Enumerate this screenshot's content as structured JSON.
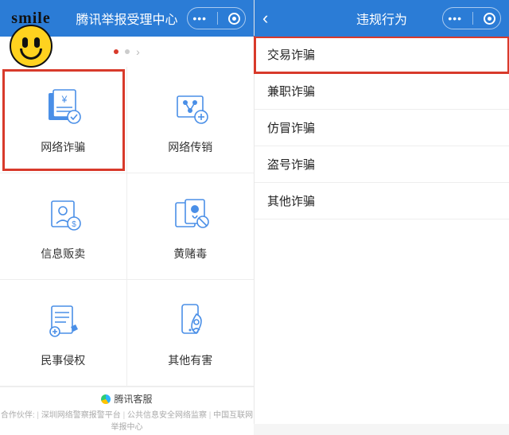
{
  "left": {
    "title": "腾讯举报受理中心",
    "smile_text": "smile",
    "grid": [
      {
        "label": "网络诈骗",
        "icon": "fraud",
        "highlight": true
      },
      {
        "label": "网络传销",
        "icon": "pyramid",
        "highlight": false
      },
      {
        "label": "信息贩卖",
        "icon": "info-sell",
        "highlight": false
      },
      {
        "label": "黄赌毒",
        "icon": "illegal",
        "highlight": false
      },
      {
        "label": "民事侵权",
        "icon": "civil",
        "highlight": false
      },
      {
        "label": "其他有害",
        "icon": "other",
        "highlight": false
      }
    ],
    "footer_brand": "腾讯客服",
    "footer_prefix": "合作伙伴",
    "footer_links": [
      "深圳网络警察报警平台",
      "公共信息安全网络监察",
      "中国互联网举报中心"
    ]
  },
  "right": {
    "title": "违规行为",
    "items": [
      {
        "label": "交易诈骗",
        "highlight": true
      },
      {
        "label": "兼职诈骗",
        "highlight": false
      },
      {
        "label": "仿冒诈骗",
        "highlight": false
      },
      {
        "label": "盗号诈骗",
        "highlight": false
      },
      {
        "label": "其他诈骗",
        "highlight": false
      }
    ]
  },
  "colors": {
    "primary": "#2b7cd6",
    "highlight": "#d83a2b"
  }
}
